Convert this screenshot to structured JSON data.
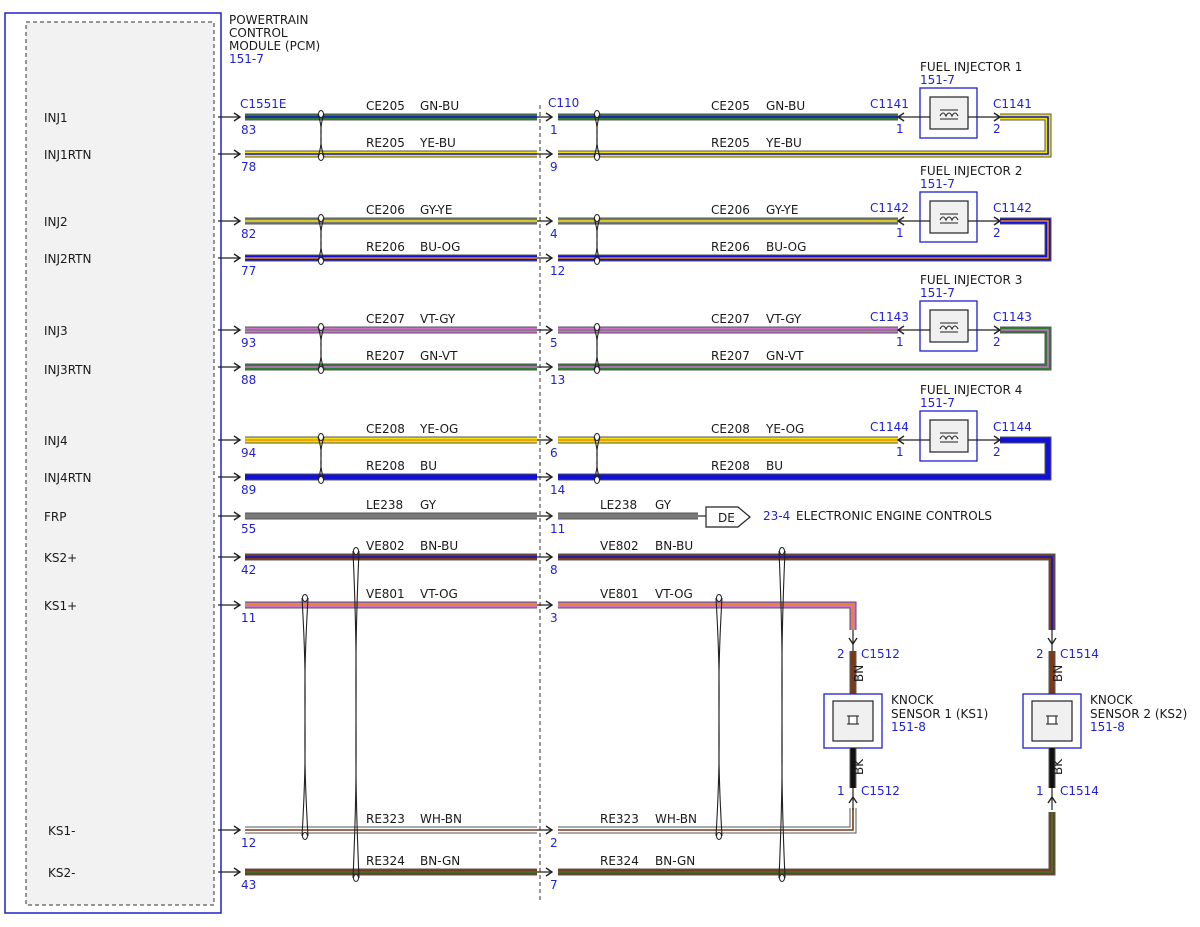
{
  "pcm": {
    "title_lines": [
      "POWERTRAIN",
      "CONTROL",
      "MODULE (PCM)"
    ],
    "ref": "151-7",
    "connector": "C1551E"
  },
  "c110": {
    "name": "C110"
  },
  "pins": {
    "inj1": "INJ1",
    "inj1rtn": "INJ1RTN",
    "inj2": "INJ2",
    "inj2rtn": "INJ2RTN",
    "inj3": "INJ3",
    "inj3rtn": "INJ3RTN",
    "inj4": "INJ4",
    "inj4rtn": "INJ4RTN",
    "frp": "FRP",
    "ks2p": "KS2+",
    "ks1p": "KS1+",
    "ks1m": "KS1-",
    "ks2m": "KS2-"
  },
  "wires": {
    "w1": {
      "circuit": "CE205",
      "color": "GN-BU",
      "pcm_pin": "83",
      "c110_pin": "1"
    },
    "w2": {
      "circuit": "RE205",
      "color": "YE-BU",
      "pcm_pin": "78",
      "c110_pin": "9"
    },
    "w3": {
      "circuit": "CE206",
      "color": "GY-YE",
      "pcm_pin": "82",
      "c110_pin": "4"
    },
    "w4": {
      "circuit": "RE206",
      "color": "BU-OG",
      "pcm_pin": "77",
      "c110_pin": "12"
    },
    "w5": {
      "circuit": "CE207",
      "color": "VT-GY",
      "pcm_pin": "93",
      "c110_pin": "5"
    },
    "w6": {
      "circuit": "RE207",
      "color": "GN-VT",
      "pcm_pin": "88",
      "c110_pin": "13"
    },
    "w7": {
      "circuit": "CE208",
      "color": "YE-OG",
      "pcm_pin": "94",
      "c110_pin": "6"
    },
    "w8": {
      "circuit": "RE208",
      "color": "BU",
      "pcm_pin": "89",
      "c110_pin": "14"
    },
    "w9": {
      "circuit": "LE238",
      "color": "GY",
      "pcm_pin": "55",
      "c110_pin": "11"
    },
    "w10": {
      "circuit": "VE802",
      "color": "BN-BU",
      "pcm_pin": "42",
      "c110_pin": "8"
    },
    "w11": {
      "circuit": "VE801",
      "color": "VT-OG",
      "pcm_pin": "11",
      "c110_pin": "3"
    },
    "w12": {
      "circuit": "RE323",
      "color": "WH-BN",
      "pcm_pin": "12",
      "c110_pin": "2"
    },
    "w13": {
      "circuit": "RE324",
      "color": "BN-GN",
      "pcm_pin": "43",
      "c110_pin": "7"
    }
  },
  "injectors": {
    "i1": {
      "title": "FUEL INJECTOR 1",
      "ref": "151-7",
      "conn": "C1141",
      "pin_a": "1",
      "pin_b": "2"
    },
    "i2": {
      "title": "FUEL INJECTOR 2",
      "ref": "151-7",
      "conn": "C1142",
      "pin_a": "1",
      "pin_b": "2"
    },
    "i3": {
      "title": "FUEL INJECTOR 3",
      "ref": "151-7",
      "conn": "C1143",
      "pin_a": "1",
      "pin_b": "2"
    },
    "i4": {
      "title": "FUEL INJECTOR 4",
      "ref": "151-7",
      "conn": "C1144",
      "pin_a": "1",
      "pin_b": "2"
    }
  },
  "offpage": {
    "tag": "DE",
    "ref": "23-4",
    "label": "ELECTRONIC ENGINE CONTROLS"
  },
  "knock": {
    "ks1": {
      "title_lines": [
        "KNOCK",
        "SENSOR 1 (KS1)"
      ],
      "ref": "151-8",
      "conn": "C1512",
      "pin_top": "2",
      "pin_bot": "1",
      "wire_top": "BN",
      "wire_bot": "BK"
    },
    "ks2": {
      "title_lines": [
        "KNOCK",
        "SENSOR 2 (KS2)"
      ],
      "ref": "151-8",
      "conn": "C1514",
      "pin_top": "2",
      "pin_bot": "1",
      "wire_top": "BN",
      "wire_bot": "BK"
    }
  },
  "colors": {
    "outline_blue": "#2020d0",
    "GN": "#2e7d32",
    "BU": "#1010d8",
    "YE": "#f2e600",
    "GY": "#7a7a7a",
    "VT": "#d070d0",
    "OG": "#f08a00",
    "BN": "#7a3a1a",
    "WH": "#ffffff",
    "PK": "#f090a8",
    "RD": "#c0392b",
    "BK": "#111111"
  }
}
